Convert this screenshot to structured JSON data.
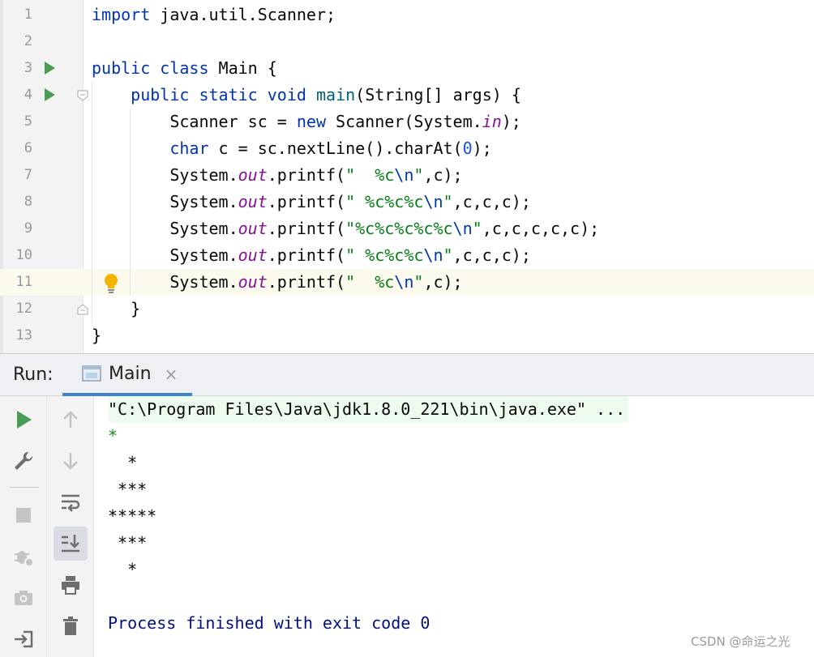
{
  "editor": {
    "lines": [
      {
        "num": "1",
        "segments": [
          {
            "t": "import",
            "c": "kw"
          },
          {
            "t": " java.util.Scanner;",
            "c": ""
          }
        ]
      },
      {
        "num": "2",
        "segments": []
      },
      {
        "num": "3",
        "segments": [
          {
            "t": "public",
            "c": "kw"
          },
          {
            "t": " ",
            "c": ""
          },
          {
            "t": "class",
            "c": "kw"
          },
          {
            "t": " Main {",
            "c": ""
          }
        ]
      },
      {
        "num": "4",
        "segments": [
          {
            "t": "    ",
            "c": ""
          },
          {
            "t": "public",
            "c": "kw"
          },
          {
            "t": " ",
            "c": ""
          },
          {
            "t": "static",
            "c": "kw"
          },
          {
            "t": " ",
            "c": ""
          },
          {
            "t": "void",
            "c": "kw"
          },
          {
            "t": " ",
            "c": ""
          },
          {
            "t": "main",
            "c": "fn"
          },
          {
            "t": "(String[] args) {",
            "c": ""
          }
        ]
      },
      {
        "num": "5",
        "segments": [
          {
            "t": "        Scanner sc = ",
            "c": ""
          },
          {
            "t": "new",
            "c": "kw"
          },
          {
            "t": " Scanner(System.",
            "c": ""
          },
          {
            "t": "in",
            "c": "fld"
          },
          {
            "t": ");",
            "c": ""
          }
        ]
      },
      {
        "num": "6",
        "segments": [
          {
            "t": "        ",
            "c": ""
          },
          {
            "t": "char",
            "c": "kw"
          },
          {
            "t": " c = sc.nextLine().charAt(",
            "c": ""
          },
          {
            "t": "0",
            "c": "num"
          },
          {
            "t": ");",
            "c": ""
          }
        ]
      },
      {
        "num": "7",
        "segments": [
          {
            "t": "        System.",
            "c": ""
          },
          {
            "t": "out",
            "c": "fld"
          },
          {
            "t": ".printf(",
            "c": ""
          },
          {
            "t": "\"  %c",
            "c": "str"
          },
          {
            "t": "\\n",
            "c": "esc"
          },
          {
            "t": "\"",
            "c": "str"
          },
          {
            "t": ",c);",
            "c": ""
          }
        ]
      },
      {
        "num": "8",
        "segments": [
          {
            "t": "        System.",
            "c": ""
          },
          {
            "t": "out",
            "c": "fld"
          },
          {
            "t": ".printf(",
            "c": ""
          },
          {
            "t": "\" %c%c%c",
            "c": "str"
          },
          {
            "t": "\\n",
            "c": "esc"
          },
          {
            "t": "\"",
            "c": "str"
          },
          {
            "t": ",c,c,c);",
            "c": ""
          }
        ]
      },
      {
        "num": "9",
        "segments": [
          {
            "t": "        System.",
            "c": ""
          },
          {
            "t": "out",
            "c": "fld"
          },
          {
            "t": ".printf(",
            "c": ""
          },
          {
            "t": "\"%c%c%c%c%c",
            "c": "str"
          },
          {
            "t": "\\n",
            "c": "esc"
          },
          {
            "t": "\"",
            "c": "str"
          },
          {
            "t": ",c,c,c,c,c);",
            "c": ""
          }
        ]
      },
      {
        "num": "10",
        "segments": [
          {
            "t": "        System.",
            "c": ""
          },
          {
            "t": "out",
            "c": "fld"
          },
          {
            "t": ".printf(",
            "c": ""
          },
          {
            "t": "\" %c%c%c",
            "c": "str"
          },
          {
            "t": "\\n",
            "c": "esc"
          },
          {
            "t": "\"",
            "c": "str"
          },
          {
            "t": ",c,c,c);",
            "c": ""
          }
        ]
      },
      {
        "num": "11",
        "segments": [
          {
            "t": "        System.",
            "c": ""
          },
          {
            "t": "out",
            "c": "fld"
          },
          {
            "t": ".printf(",
            "c": ""
          },
          {
            "t": "\"  %c",
            "c": "str"
          },
          {
            "t": "\\n",
            "c": "esc"
          },
          {
            "t": "\"",
            "c": "str"
          },
          {
            "t": ",c);",
            "c": ""
          }
        ]
      },
      {
        "num": "12",
        "segments": [
          {
            "t": "    }",
            "c": ""
          }
        ]
      },
      {
        "num": "13",
        "segments": [
          {
            "t": "}",
            "c": ""
          }
        ]
      }
    ]
  },
  "run_panel": {
    "title": "Run:",
    "tab_label": "Main",
    "tab_close": "×",
    "output": {
      "command": "\"C:\\Program Files\\Java\\jdk1.8.0_221\\bin\\java.exe\" ...",
      "input_line": "*",
      "lines": [
        "  *",
        " ***",
        "*****",
        " ***",
        "  *"
      ],
      "exit": "Process finished with exit code 0"
    }
  },
  "watermark": "CSDN @命运之光",
  "colors": {
    "keyword": "#0033b3",
    "string": "#067d17",
    "field": "#871094",
    "number": "#1750eb",
    "run_green": "#499c54",
    "tab_accent": "#4083c9"
  }
}
